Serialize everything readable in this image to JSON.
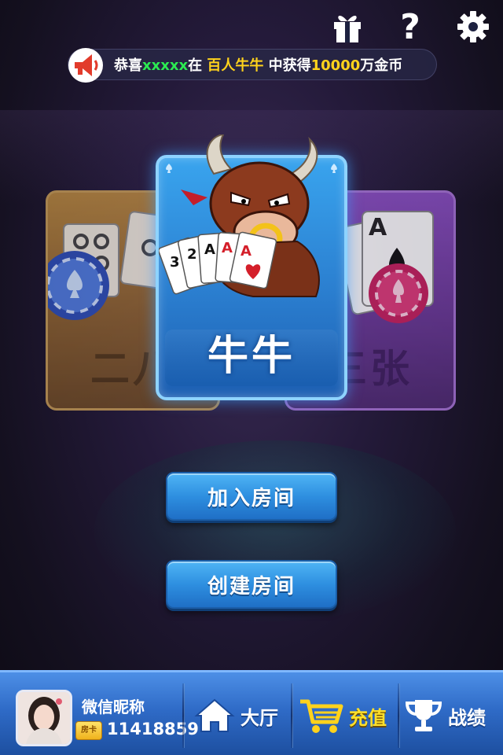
{
  "top_bar": {
    "icons": [
      "gift-icon",
      "help-icon",
      "gear-icon"
    ],
    "help_symbol": "?"
  },
  "marquee": {
    "prefix": "恭喜",
    "player": "xxxxx",
    "mid": "在",
    "game": "百人牛牛",
    "middle2": "中获得",
    "amount": "10000",
    "suffix": "万金币"
  },
  "games": {
    "left_label": "二八",
    "center_label": "牛牛",
    "right_label": "三张"
  },
  "cards_art": {
    "ranks": [
      "3",
      "2",
      "A",
      "A",
      "A"
    ],
    "right_card_rank": "A"
  },
  "actions": {
    "join_room": "加入房间",
    "create_room": "创建房间"
  },
  "user": {
    "nickname": "微信昵称",
    "gold_badge": "房卡",
    "gold": "11418859"
  },
  "nav": {
    "lobby": "大厅",
    "recharge": "充值",
    "records": "战绩"
  },
  "colors": {
    "highlight_green": "#2cea52",
    "highlight_yellow": "#ffd21c",
    "primary_blue": "#2e8fe0"
  }
}
